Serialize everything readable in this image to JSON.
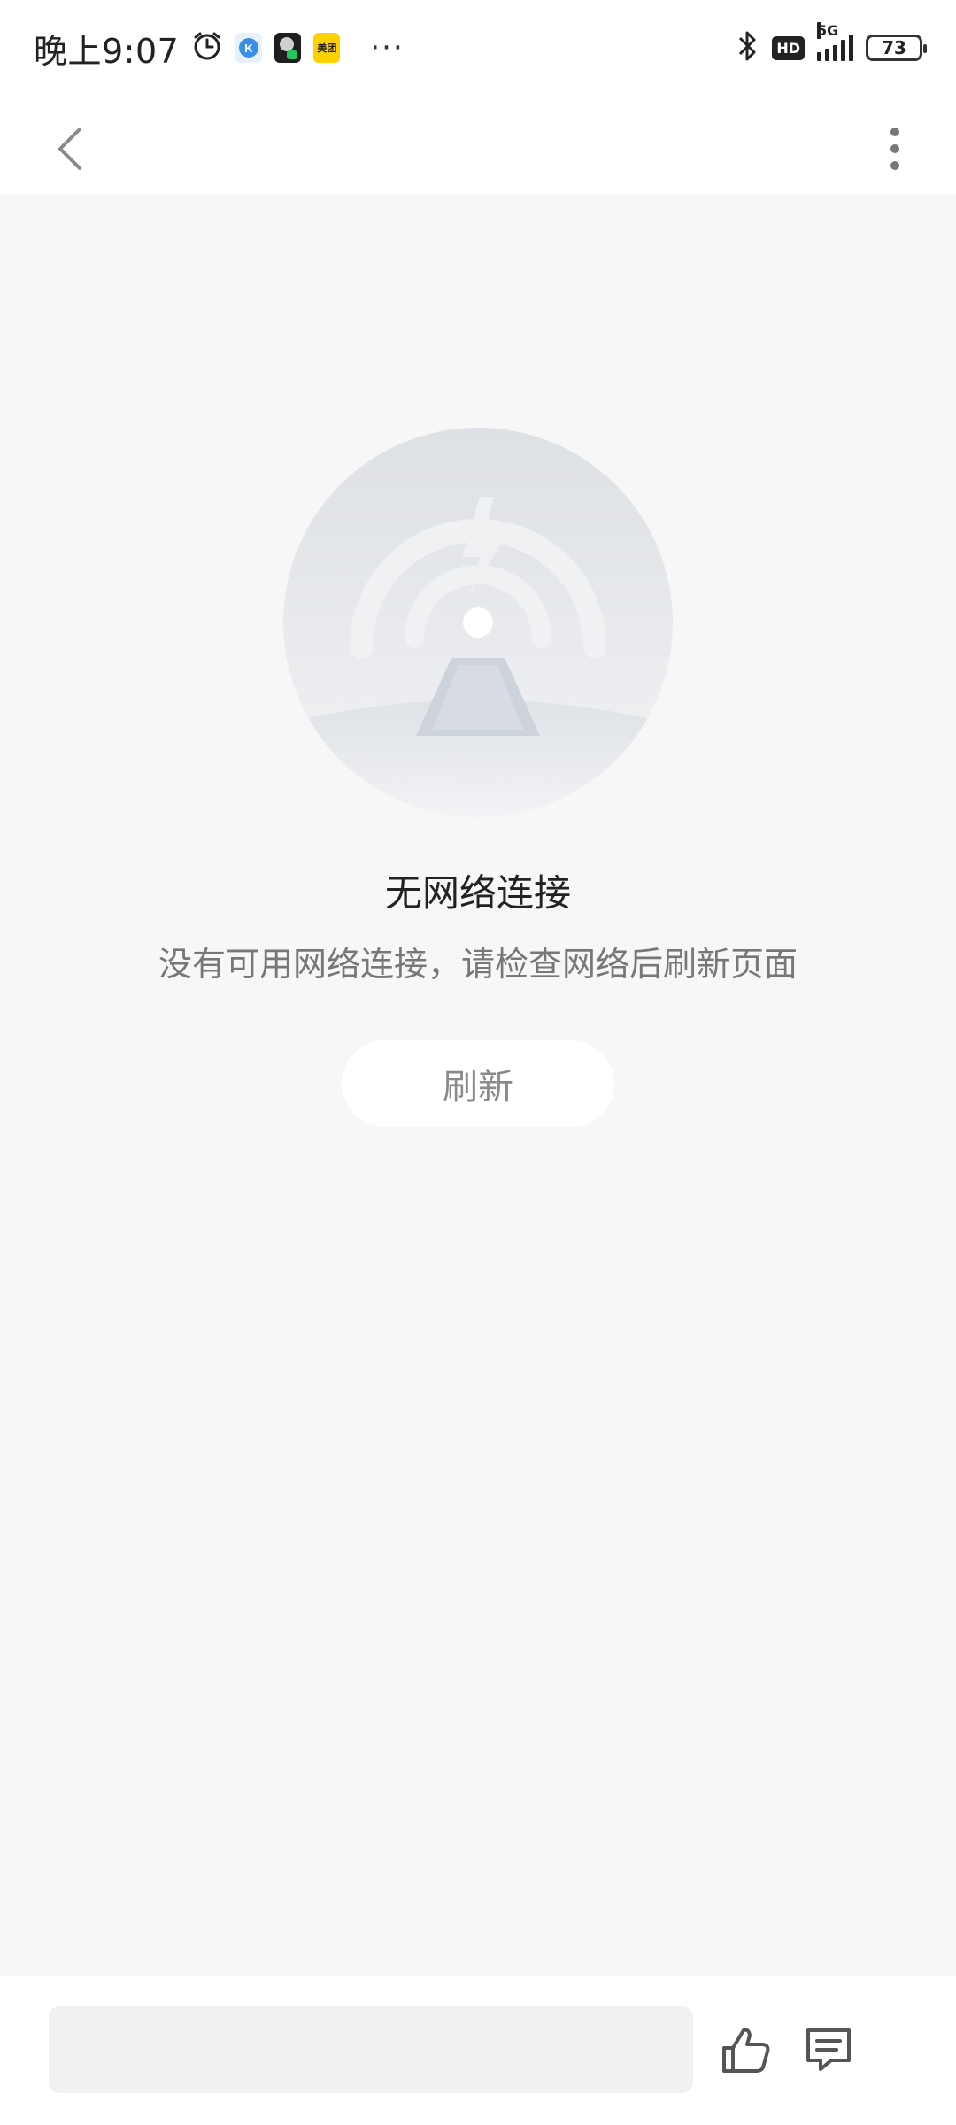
{
  "status_bar": {
    "time": "晚上9:07",
    "app_icons": [
      "alarm-icon",
      "k-app-icon",
      "wechat-icon",
      "meituan-icon"
    ],
    "meituan_label": "美团",
    "k_label": "K",
    "more": "···",
    "hd_label": "HD",
    "network_label": "5G",
    "battery": "73"
  },
  "nav": {
    "back_icon": "chevron-left-icon",
    "more_icon": "more-vertical-icon"
  },
  "empty_state": {
    "illustration": "no-network-illustration",
    "title": "无网络连接",
    "description": "没有可用网络连接，请检查网络后刷新页面",
    "refresh_label": "刷新"
  },
  "bottom_bar": {
    "comment_placeholder": "",
    "like_icon": "thumbs-up-icon",
    "comment_icon": "comment-icon"
  },
  "colors": {
    "page_bg": "#f7f7f7",
    "bar_bg": "#ffffff",
    "input_bg": "#f0f1f3",
    "title": "#222222",
    "desc": "#777777"
  }
}
